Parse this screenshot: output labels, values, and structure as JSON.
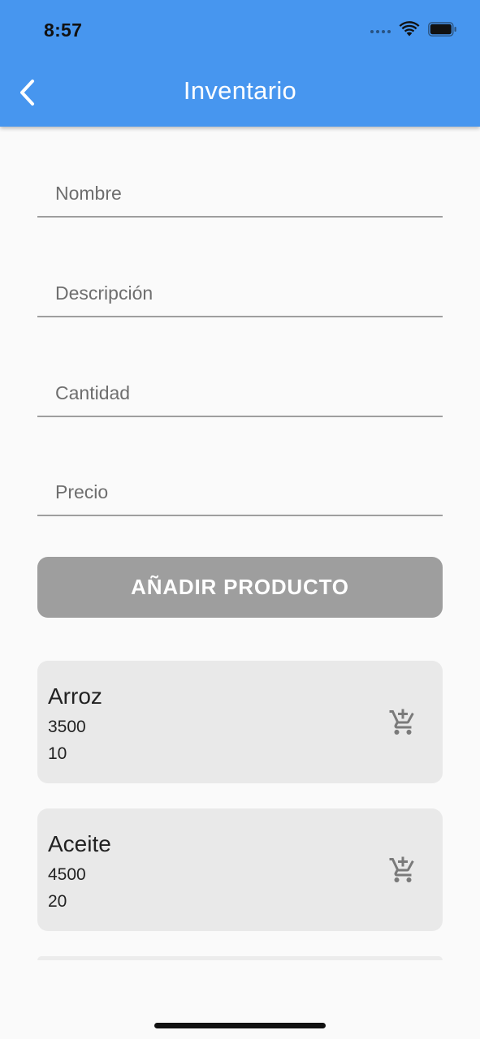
{
  "status_bar": {
    "time": "8:57"
  },
  "app_bar": {
    "title": "Inventario",
    "back_icon": "chevron-left-icon"
  },
  "form": {
    "nombre_placeholder": "Nombre",
    "descripcion_placeholder": "Descripción",
    "cantidad_placeholder": "Cantidad",
    "precio_placeholder": "Precio",
    "add_button_label": "AÑADIR PRODUCTO"
  },
  "products": [
    {
      "name": "Arroz",
      "price": "3500",
      "quantity": "10",
      "icon": "add-shopping-cart-icon"
    },
    {
      "name": "Aceite",
      "price": "4500",
      "quantity": "20",
      "icon": "add-shopping-cart-icon"
    }
  ],
  "colors": {
    "app_bar": "#4796ef",
    "button": "#9e9e9e",
    "card": "#e9e9e9",
    "background": "#fafafa"
  }
}
